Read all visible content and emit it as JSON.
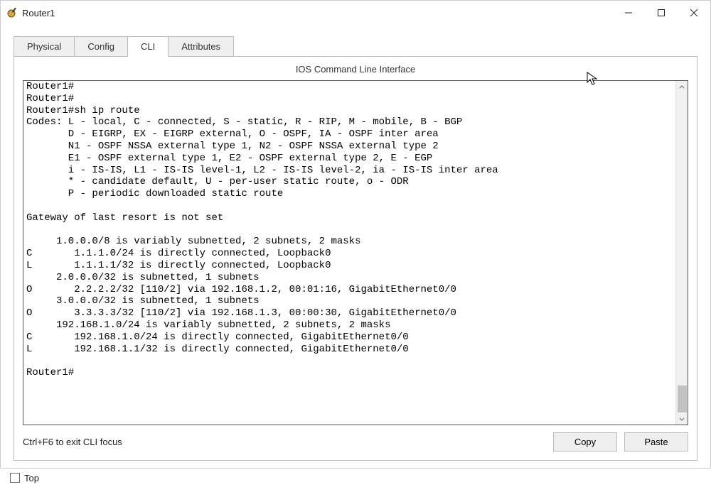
{
  "window": {
    "title": "Router1"
  },
  "tabs": {
    "physical": "Physical",
    "config": "Config",
    "cli": "CLI",
    "attributes": "Attributes",
    "active": "cli"
  },
  "panel": {
    "title": "IOS Command Line Interface"
  },
  "cli_output": "Router1#\nRouter1#\nRouter1#sh ip route\nCodes: L - local, C - connected, S - static, R - RIP, M - mobile, B - BGP\n       D - EIGRP, EX - EIGRP external, O - OSPF, IA - OSPF inter area\n       N1 - OSPF NSSA external type 1, N2 - OSPF NSSA external type 2\n       E1 - OSPF external type 1, E2 - OSPF external type 2, E - EGP\n       i - IS-IS, L1 - IS-IS level-1, L2 - IS-IS level-2, ia - IS-IS inter area\n       * - candidate default, U - per-user static route, o - ODR\n       P - periodic downloaded static route\n\nGateway of last resort is not set\n\n     1.0.0.0/8 is variably subnetted, 2 subnets, 2 masks\nC       1.1.1.0/24 is directly connected, Loopback0\nL       1.1.1.1/32 is directly connected, Loopback0\n     2.0.0.0/32 is subnetted, 1 subnets\nO       2.2.2.2/32 [110/2] via 192.168.1.2, 00:01:16, GigabitEthernet0/0\n     3.0.0.0/32 is subnetted, 1 subnets\nO       3.3.3.3/32 [110/2] via 192.168.1.3, 00:00:30, GigabitEthernet0/0\n     192.168.1.0/24 is variably subnetted, 2 subnets, 2 masks\nC       192.168.1.0/24 is directly connected, GigabitEthernet0/0\nL       192.168.1.1/32 is directly connected, GigabitEthernet0/0\n\nRouter1#",
  "footer": {
    "hint": "Ctrl+F6 to exit CLI focus",
    "copy": "Copy",
    "paste": "Paste"
  },
  "bottom": {
    "top_label": "Top"
  }
}
